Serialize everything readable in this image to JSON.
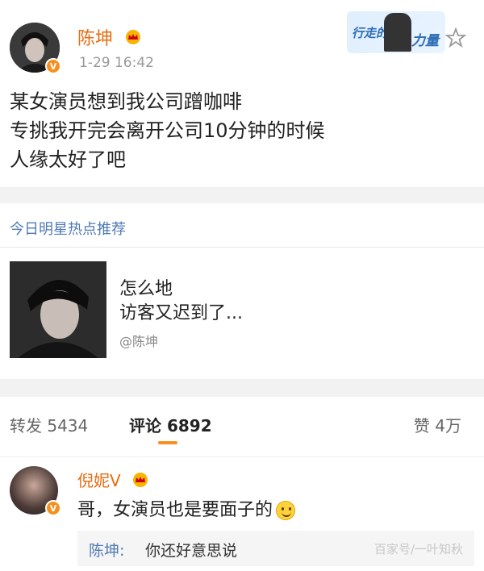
{
  "post": {
    "username": "陈坤",
    "timestamp": "1-29 16:42",
    "verified": "V",
    "badge": {
      "text1": "行走的",
      "text2": "力量"
    },
    "body_lines": [
      "某女演员想到我公司蹭咖啡",
      "专挑我开完会离开公司10分钟的时候",
      "人缘太好了吧"
    ]
  },
  "recommendation": {
    "header": "今日明星热点推荐",
    "line1": "怎么地",
    "line2": "访客又迟到了...",
    "mention": "@陈坤"
  },
  "actions": {
    "repost": "转发 5434",
    "comment": "评论 6892",
    "like": "赞 4万"
  },
  "comment": {
    "username": "倪妮V",
    "verified": "V",
    "text": "哥，女演员也是要面子的",
    "reply": {
      "username": "陈坤:",
      "text": "你还好意思说"
    }
  },
  "watermark": "百家号/一叶知秋"
}
